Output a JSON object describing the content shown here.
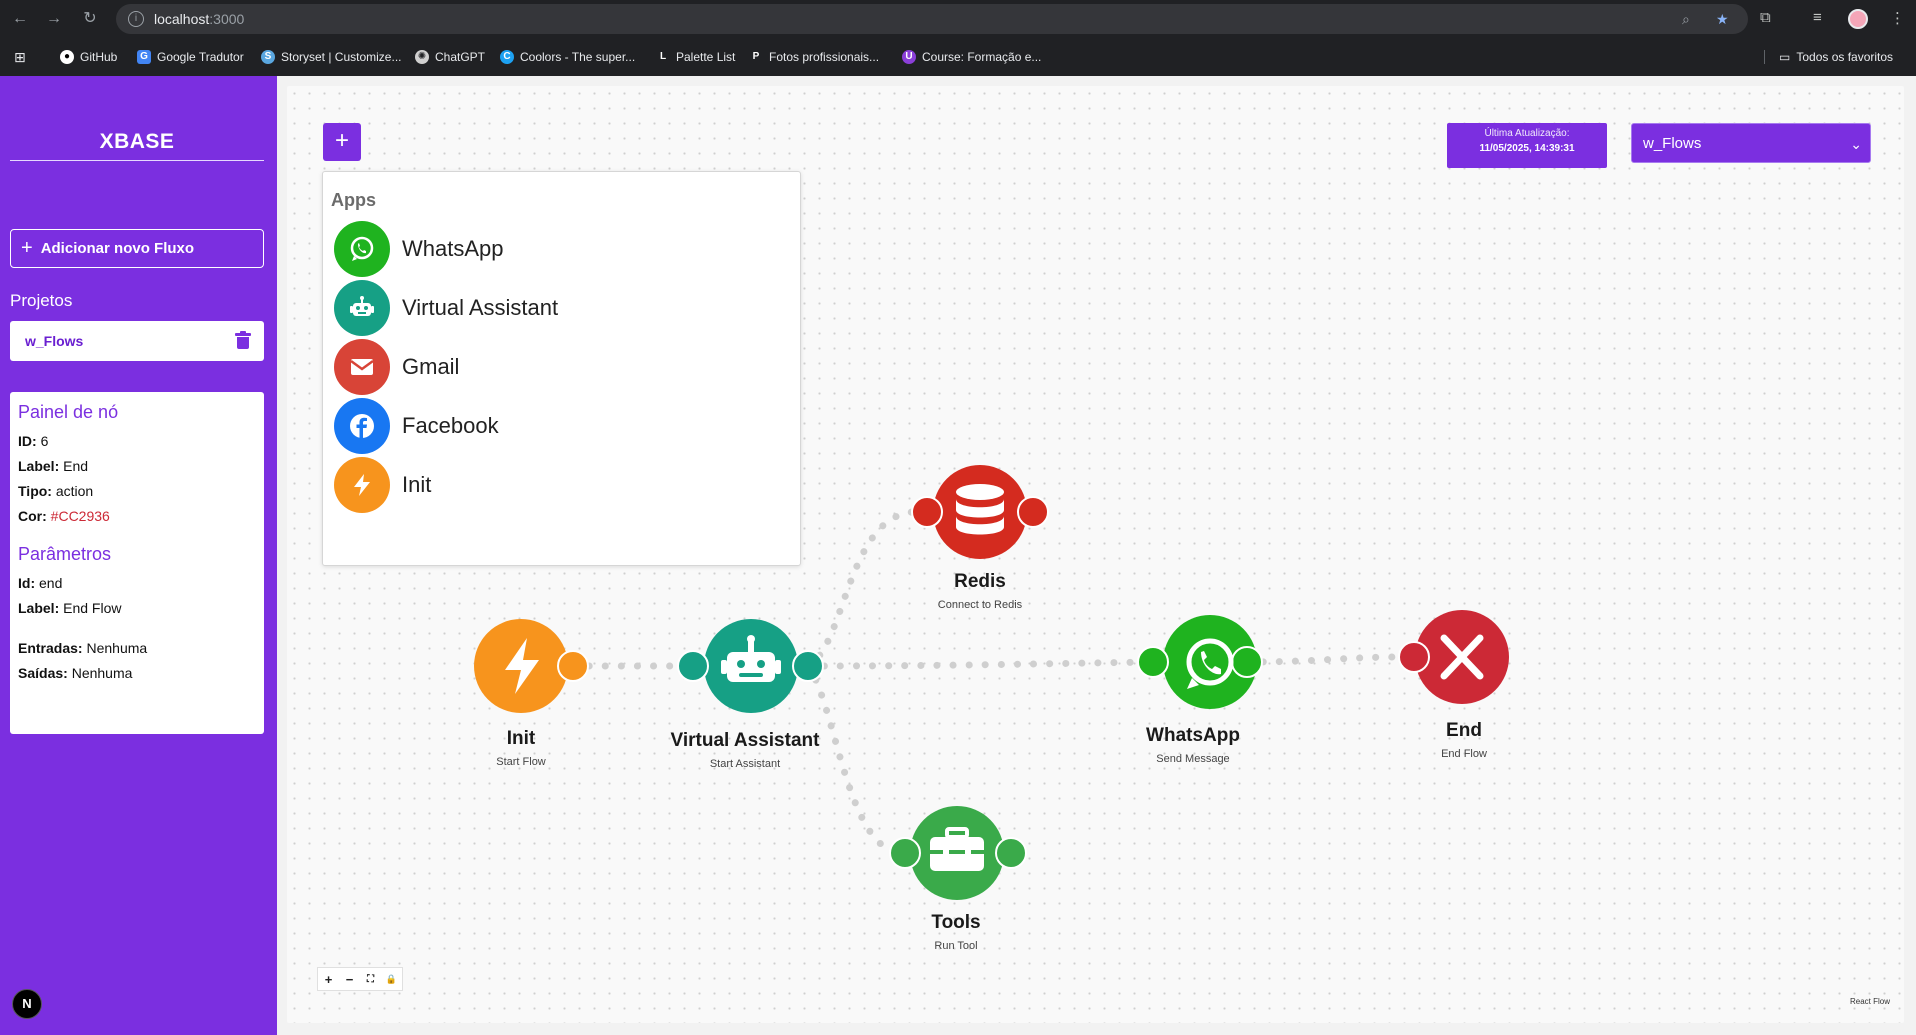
{
  "browser": {
    "url_host": "localhost",
    "url_port": ":3000",
    "bookmarks": [
      {
        "label": "GitHub",
        "color": "#ffffff"
      },
      {
        "label": "Google Tradutor",
        "color": "#4285f4"
      },
      {
        "label": "Storyset | Customize...",
        "color": "#5aa7e0"
      },
      {
        "label": "ChatGPT",
        "color": "#d0d0d0"
      },
      {
        "label": "Coolors - The super...",
        "color": "#1da1f2"
      },
      {
        "label": "Palette List",
        "color": "#ffffff"
      },
      {
        "label": "Fotos profissionais...",
        "color": "#ffffff"
      },
      {
        "label": "Course: Formação e...",
        "color": "#8b3fd9"
      }
    ],
    "favorites_label": "Todos os favoritos"
  },
  "sidebar": {
    "brand": "XBASE",
    "add_flow_label": "Adicionar novo Fluxo",
    "projects_title": "Projetos",
    "project_name": "w_Flows",
    "next_badge": "N"
  },
  "node_panel": {
    "title": "Painel de nó",
    "id_label": "ID:",
    "id_value": "6",
    "label_label": "Label:",
    "label_value": "End",
    "type_label": "Tipo:",
    "type_value": "action",
    "color_label": "Cor:",
    "color_value": "#CC2936",
    "params_title": "Parâmetros",
    "param_id_label": "Id:",
    "param_id_value": "end",
    "param_label_label": "Label:",
    "param_label_value": "End Flow",
    "inputs_label": "Entradas:",
    "inputs_value": "Nenhuma",
    "outputs_label": "Saídas:",
    "outputs_value": "Nenhuma"
  },
  "toolbar": {
    "plus_label": "+",
    "last_update_title": "Última Atualização:",
    "last_update_value": "11/05/2025, 14:39:31",
    "flow_select_value": "w_Flows"
  },
  "apps_menu": {
    "title": "Apps",
    "items": [
      {
        "label": "WhatsApp",
        "icon": "whatsapp-icon",
        "color": "#1fb31f"
      },
      {
        "label": "Virtual Assistant",
        "icon": "robot-icon",
        "color": "#16a085"
      },
      {
        "label": "Gmail",
        "icon": "mail-icon",
        "color": "#d84437"
      },
      {
        "label": "Facebook",
        "icon": "facebook-icon",
        "color": "#1877f2"
      },
      {
        "label": "Init",
        "icon": "lightning-icon",
        "color": "#f7941d"
      }
    ]
  },
  "flow": {
    "nodes": [
      {
        "name": "Init",
        "sub": "Start Flow",
        "color": "#f7941d"
      },
      {
        "name": "Virtual Assistant",
        "sub": "Start Assistant",
        "color": "#16a085"
      },
      {
        "name": "WhatsApp",
        "sub": "Send Message",
        "color": "#1fb31f"
      },
      {
        "name": "End",
        "sub": "End Flow",
        "color": "#cc2936"
      },
      {
        "name": "Redis",
        "sub": "Connect to Redis",
        "color": "#d42b1f"
      },
      {
        "name": "Tools",
        "sub": "Run Tool",
        "color": "#3aaa4a"
      }
    ]
  },
  "controls": {
    "zoom_in": "+",
    "zoom_out": "−",
    "fit": "⛶",
    "lock": "🔒",
    "attribution": "React Flow"
  }
}
